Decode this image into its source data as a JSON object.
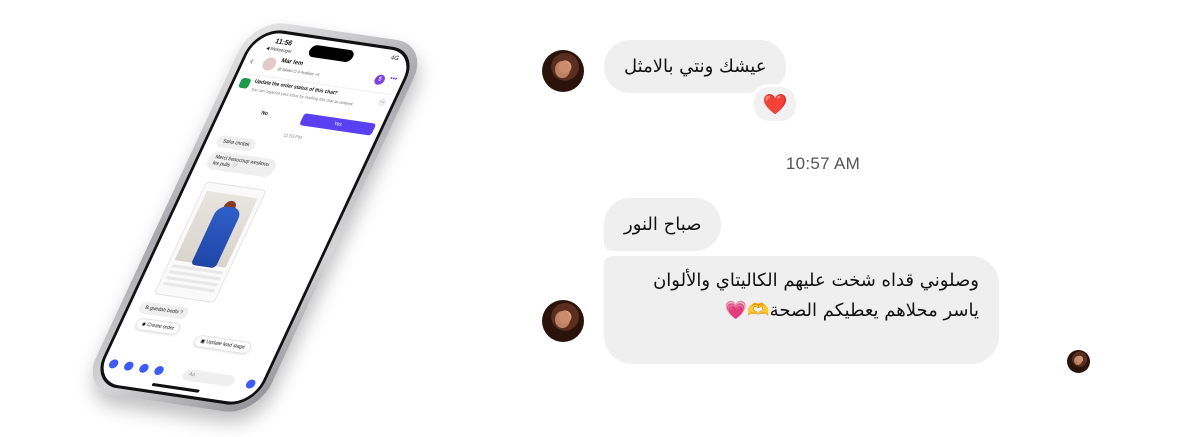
{
  "phone": {
    "status_time": "11:56",
    "status_back": "◀ Messenger",
    "status_right": "4G",
    "contact_name": "Mar lem",
    "contact_sub": "@ bilake  ⛭ 4 Avaliser  +4",
    "money_icon": "$",
    "more_icon": "•••",
    "banner_title": "Update the order status of this chat?",
    "banner_sub": "You can organize your inbox by marking this chat as ordered.",
    "no_label": "No",
    "yes_label": "Yes",
    "time": "11:53 PM",
    "msg1": "Saha chribtk",
    "msg2": "Merci beaucoup wesltnou les pulls 🤍",
    "msg3": "B.guedah bedhi ?",
    "chip_create_order": "Create order",
    "chip_update_lead": "Update lead stage",
    "composer_placeholder": "Aa"
  },
  "chat": {
    "messages": [
      {
        "text": "عيشك ونتي بالامثل",
        "reaction": "❤️"
      },
      {
        "text": "صباح النور"
      },
      {
        "line1": "وصلوني قداه شخت عليهم الكاليتاي والألوان",
        "line2_text": "ياسر محلاهم يعطيكم الصحة",
        "line2_emoji_hands": "🫶",
        "line2_emoji_heart": "💗"
      }
    ],
    "timestamp": "10:57 AM"
  },
  "colors": {
    "bubble_bg": "#efefef",
    "accent": "#5b3ff2",
    "reaction_heart": "#e02020"
  }
}
